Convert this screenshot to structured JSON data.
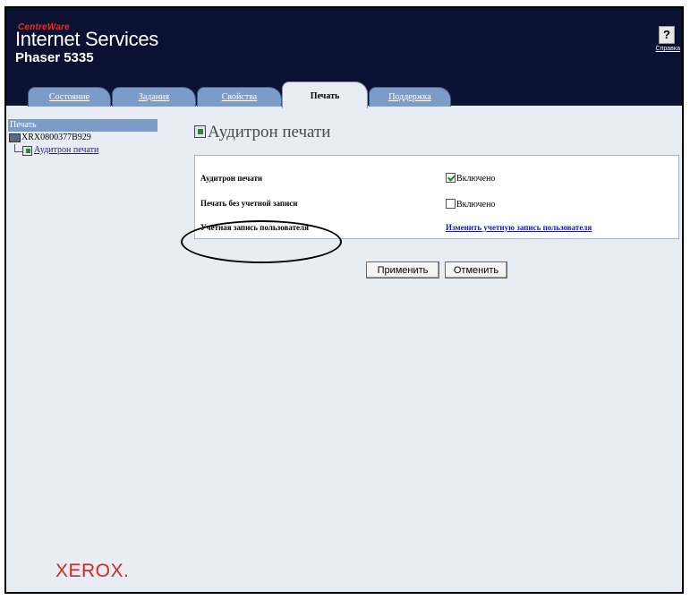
{
  "header": {
    "brand_line1": "CentreWare",
    "brand_line2": "Internet Services",
    "model": "Phaser 5335",
    "help_label": "Справка"
  },
  "tabs": [
    {
      "label": "Состояние",
      "active": false
    },
    {
      "label": "Задания",
      "active": false
    },
    {
      "label": "Свойства",
      "active": false
    },
    {
      "label": "Печать",
      "active": true
    },
    {
      "label": "Поддержка",
      "active": false
    }
  ],
  "sidebar": {
    "header": "Печать",
    "device": "XRX0800377B929",
    "link": "Аудитрон печати"
  },
  "main": {
    "title": "Аудитрон печати",
    "rows": [
      {
        "label": "Аудитрон печати",
        "checkbox_label": "Включено",
        "checked": true
      },
      {
        "label": "Печать без учетной записи",
        "checkbox_label": "Включено",
        "checked": false
      },
      {
        "label": "Учетная запись пользователя",
        "link": "Изменить учетную запись пользователя"
      }
    ],
    "apply_label": "Применить",
    "cancel_label": "Отменить"
  },
  "footer": {
    "logo": "XEROX."
  },
  "colors": {
    "header_bg": "#0b1133",
    "tab_bg": "#7d9bc7",
    "page_bg": "#e8edf4",
    "brand_red": "#d4281f"
  }
}
